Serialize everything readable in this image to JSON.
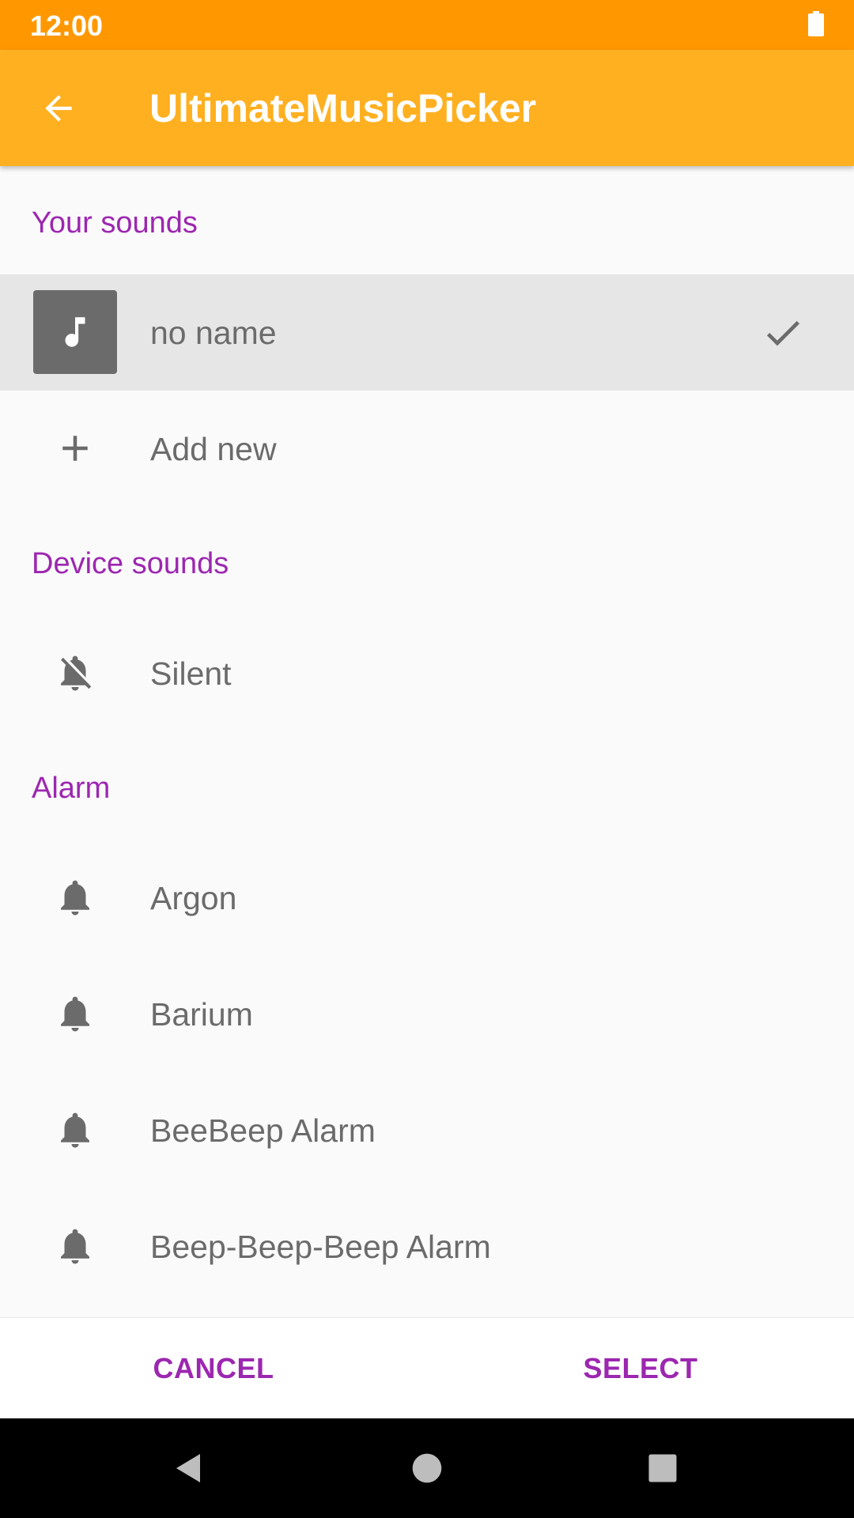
{
  "status_bar": {
    "time": "12:00"
  },
  "app_bar": {
    "title": "UltimateMusicPicker"
  },
  "sections": {
    "your_sounds": "Your sounds",
    "device_sounds": "Device sounds",
    "alarm": "Alarm"
  },
  "your_sounds": {
    "selected_item": "no name",
    "add_new": "Add new"
  },
  "device_sounds": {
    "silent": "Silent"
  },
  "alarm_items": [
    "Argon",
    "Barium",
    "BeeBeep Alarm",
    "Beep-Beep-Beep Alarm"
  ],
  "actions": {
    "cancel": "CANCEL",
    "select": "SELECT"
  },
  "colors": {
    "status_bar": "#ff9800",
    "app_bar": "#ffb020",
    "accent": "#9c27b0",
    "icon_gray": "#6b6b6b",
    "selected_row": "#e6e6e6"
  },
  "icons": {
    "back": "arrow-left-icon",
    "music": "music-note-icon",
    "check": "check-icon",
    "add": "plus-icon",
    "silent": "bell-off-icon",
    "alarm": "bell-icon"
  }
}
